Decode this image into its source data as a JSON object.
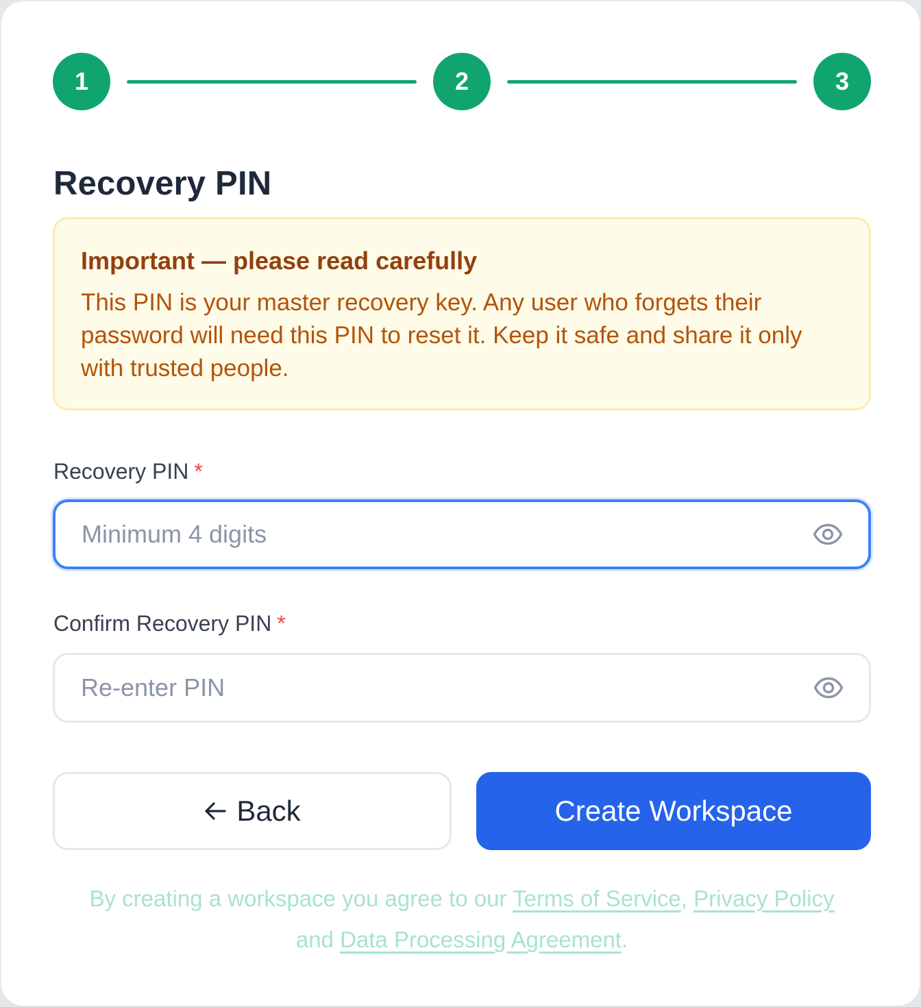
{
  "stepper": {
    "steps": [
      "1",
      "2",
      "3"
    ],
    "current_step": 3,
    "color": "#10a56f"
  },
  "page": {
    "title": "Recovery PIN"
  },
  "alert": {
    "title": "Important — please read carefully",
    "body": "This PIN is your master recovery key. Any user who forgets their password will need this PIN to reset it. Keep it safe and share it only with trusted people."
  },
  "fields": {
    "pin": {
      "label": "Recovery PIN",
      "required_mark": "*",
      "value": "",
      "placeholder": "Minimum 4 digits",
      "icon": "eye-icon"
    },
    "confirm_pin": {
      "label": "Confirm Recovery PIN",
      "required_mark": "*",
      "value": "",
      "placeholder": "Re-enter PIN",
      "icon": "eye-icon"
    }
  },
  "buttons": {
    "back_label": "Back",
    "back_icon": "arrow-left-icon",
    "create_label": "Create Workspace",
    "primary_color": "#2563eb"
  },
  "legal": {
    "prefix": "By creating a workspace you agree to our",
    "terms": "Terms of Service",
    "comma": ",",
    "privacy": "Privacy Policy",
    "and": "and",
    "dpa": "Data Processing Agreement",
    "period": "."
  }
}
